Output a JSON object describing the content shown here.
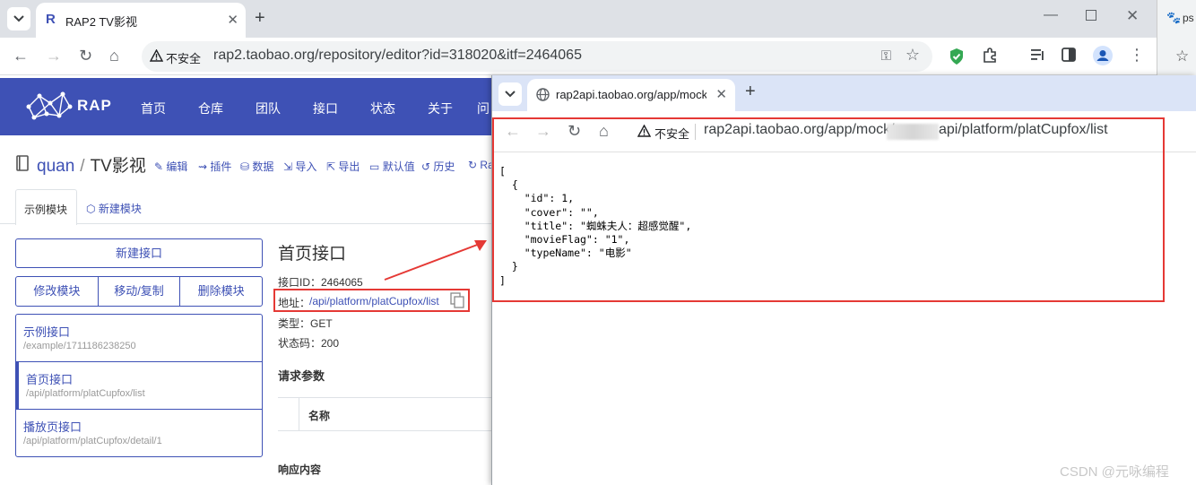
{
  "browser": {
    "tab_title": "RAP2 TV影视",
    "url": "rap2.taobao.org/repository/editor?id=318020&itf=2464065",
    "insecure_label": "不安全",
    "other_tab_label": "ps"
  },
  "rap": {
    "logo_text": "RAP",
    "nav": [
      "首页",
      "仓库",
      "团队",
      "接口",
      "状态",
      "关于",
      "问"
    ],
    "repo_owner": "quan",
    "repo_sep": "/",
    "repo_name": "TV影视",
    "actions": [
      "编辑",
      "插件",
      "数据",
      "导入",
      "导出",
      "默认值",
      "历史",
      "Ra"
    ],
    "module_tabs": [
      "示例模块",
      "新建模块"
    ],
    "new_api_button": "新建接口",
    "module_buttons": [
      "修改模块",
      "移动/复制",
      "删除模块"
    ],
    "api_list": [
      {
        "name": "示例接口",
        "path": "/example/1711186238250"
      },
      {
        "name": "首页接口",
        "path": "/api/platform/platCupfox/list"
      },
      {
        "name": "播放页接口",
        "path": "/api/platform/platCupfox/detail/1"
      }
    ],
    "detail": {
      "title": "首页接口",
      "api_id": "接口ID：2464065",
      "address_label": "地址：",
      "address_value": "/api/platform/platCupfox/list",
      "type": "类型：GET",
      "status": "状态码：200",
      "request_params": "请求参数",
      "param_col_name": "名称",
      "response_content": "响应内容"
    }
  },
  "popup": {
    "tab_title": "rap2api.taobao.org/app/mock",
    "insecure_label": "不安全",
    "url_prefix": "rap2api.taobao.org/app/mock/",
    "url_suffix": "api/platform/platCupfox/list",
    "json_text": "[\n  {\n    \"id\": 1,\n    \"cover\": \"\",\n    \"title\": \"蜘蛛夫人：超感觉醒\",\n    \"movieFlag\": \"1\",\n    \"typeName\": \"电影\"\n  }\n]"
  },
  "watermark": "CSDN @元咏编程",
  "colors": {
    "rap_primary": "#3e51b5",
    "highlight_red": "#e53935",
    "tabstrip": "#dee1e6",
    "popup_tabstrip": "#dbe4f7"
  }
}
